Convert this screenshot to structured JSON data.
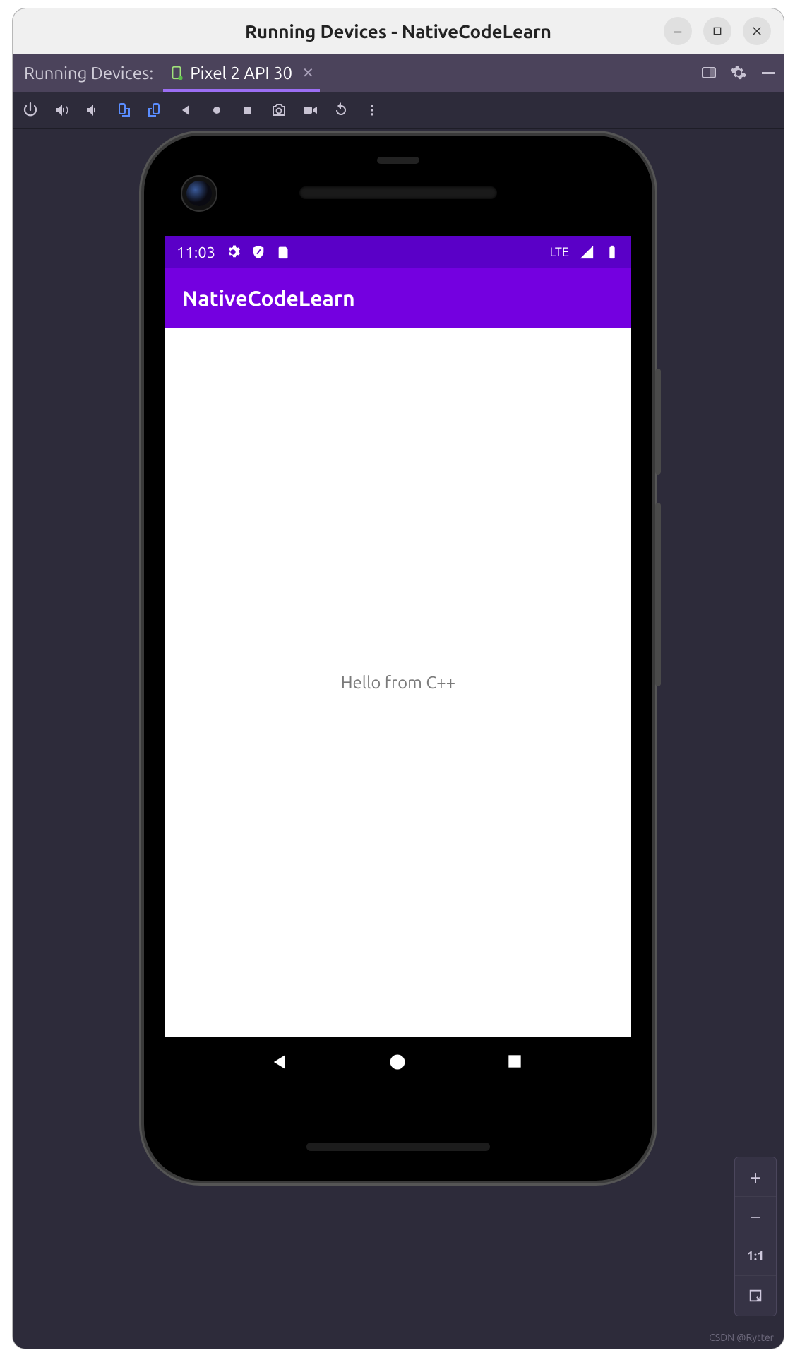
{
  "window": {
    "title": "Running Devices - NativeCodeLearn"
  },
  "tabstrip": {
    "label": "Running Devices:",
    "tab": {
      "label": "Pixel 2 API 30"
    }
  },
  "emulator": {
    "statusbar": {
      "time": "11:03",
      "network": "LTE"
    },
    "appbar": {
      "title": "NativeCodeLearn"
    },
    "content": {
      "text": "Hello from C++"
    }
  },
  "zoom": {
    "ratio": "1:1"
  },
  "watermark": "CSDN @Rytter"
}
